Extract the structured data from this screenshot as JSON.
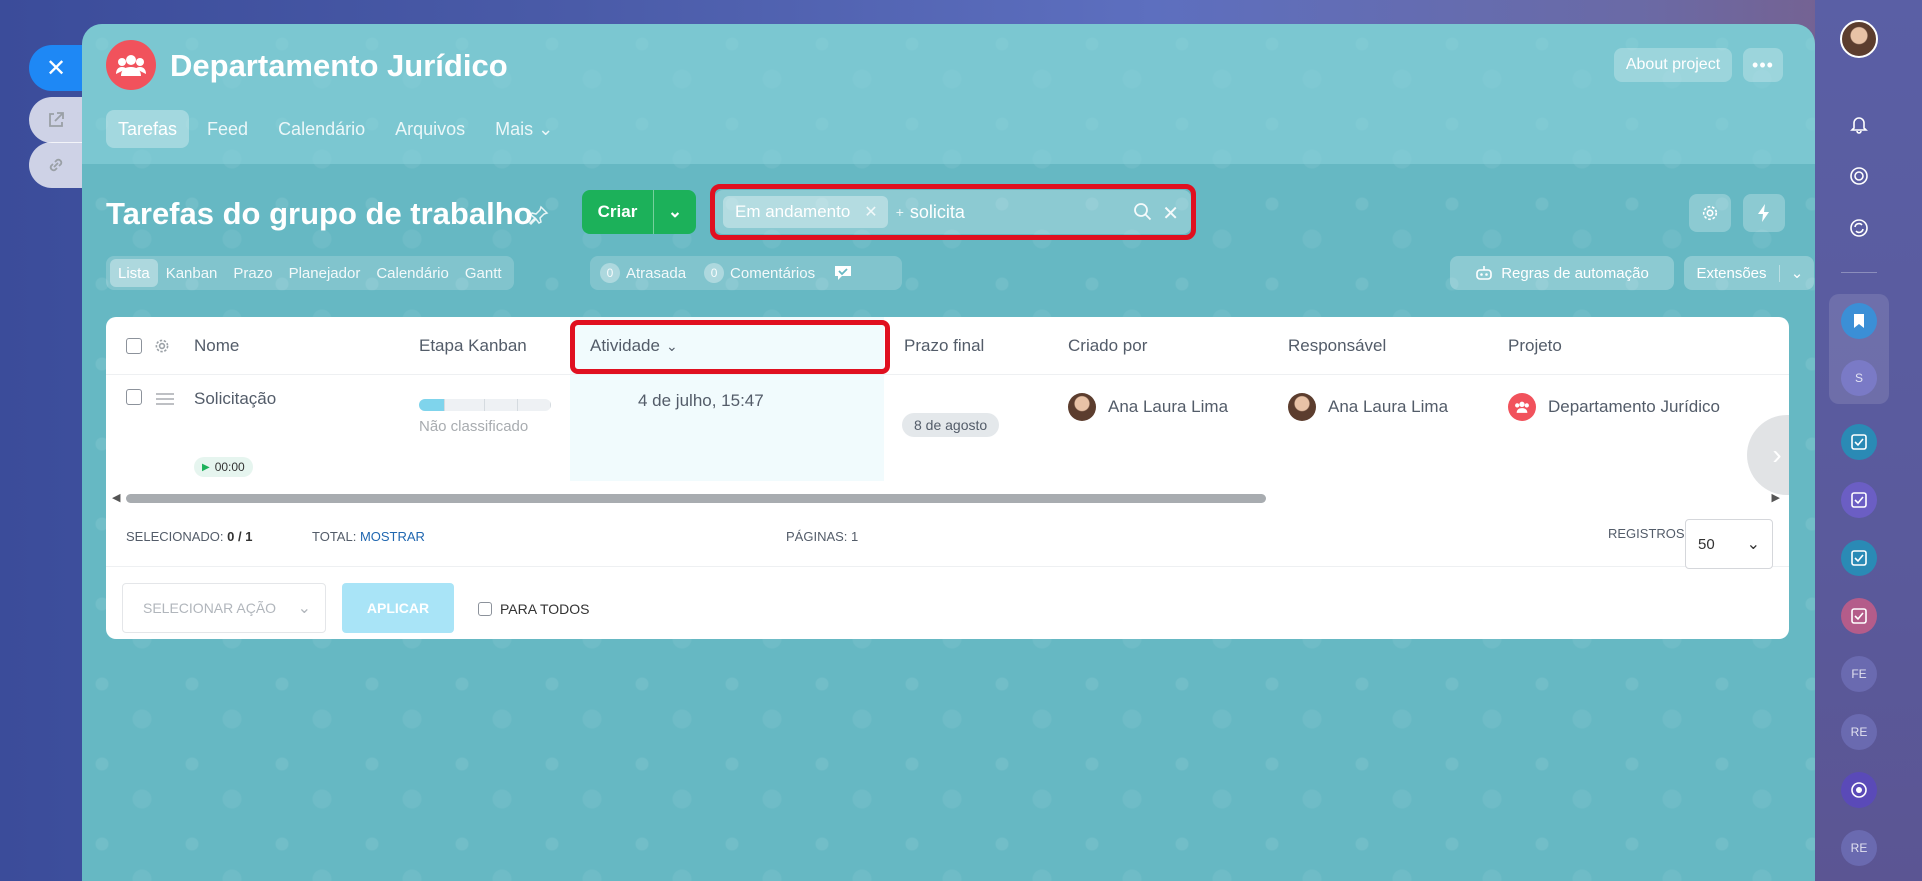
{
  "group": {
    "title": "Departamento Jurídico",
    "about_label": "About project",
    "more_label": "•••"
  },
  "top_nav": [
    {
      "label": "Tarefas"
    },
    {
      "label": "Feed"
    },
    {
      "label": "Calendário"
    },
    {
      "label": "Arquivos"
    },
    {
      "label": "Mais ⌄"
    }
  ],
  "page": {
    "title": "Tarefas do grupo de trabalho"
  },
  "create": {
    "label": "Criar"
  },
  "search": {
    "chip": "Em andamento",
    "value": "solicita"
  },
  "view_tabs": [
    {
      "label": "Lista"
    },
    {
      "label": "Kanban"
    },
    {
      "label": "Prazo"
    },
    {
      "label": "Planejador"
    },
    {
      "label": "Calendário"
    },
    {
      "label": "Gantt"
    }
  ],
  "counters": {
    "overdue_count": "0",
    "overdue_label": "Atrasada",
    "comments_count": "0",
    "comments_label": "Comentários"
  },
  "automation": {
    "label": "Regras de automação"
  },
  "extensions": {
    "label": "Extensões"
  },
  "table": {
    "headers": {
      "name": "Nome",
      "kanban": "Etapa Kanban",
      "activity": "Atividade",
      "deadline": "Prazo final",
      "created_by": "Criado por",
      "responsible": "Responsável",
      "project": "Projeto"
    },
    "row": {
      "name": "Solicitação",
      "timer": "00:00",
      "kanban_stage": "Não classificado",
      "kanban_progress": 0.2,
      "activity": "4 de julho, 15:47",
      "deadline": "8 de agosto",
      "created_by": "Ana Laura Lima",
      "responsible": "Ana Laura Lima",
      "project": "Departamento Jurídico"
    }
  },
  "footer": {
    "selected_label": "SELECIONADO:",
    "selected_value": "0 / 1",
    "total_label": "TOTAL:",
    "total_link": "MOSTRAR",
    "pages_label": "PÁGINAS:",
    "pages_value": "1",
    "records_label": "REGISTROS:",
    "records_value": "50"
  },
  "actions": {
    "select_placeholder": "SELECIONAR AÇÃO",
    "apply_label": "APLICAR",
    "for_all_label": "PARA TODOS"
  },
  "right_bar": {
    "tiles": [
      "S",
      "FE",
      "RE",
      "RE"
    ]
  },
  "colors": {
    "accent_green": "#1cb15a",
    "brand_red": "#f1525c",
    "highlight_red": "#e01020",
    "link_blue": "#2067b0"
  }
}
